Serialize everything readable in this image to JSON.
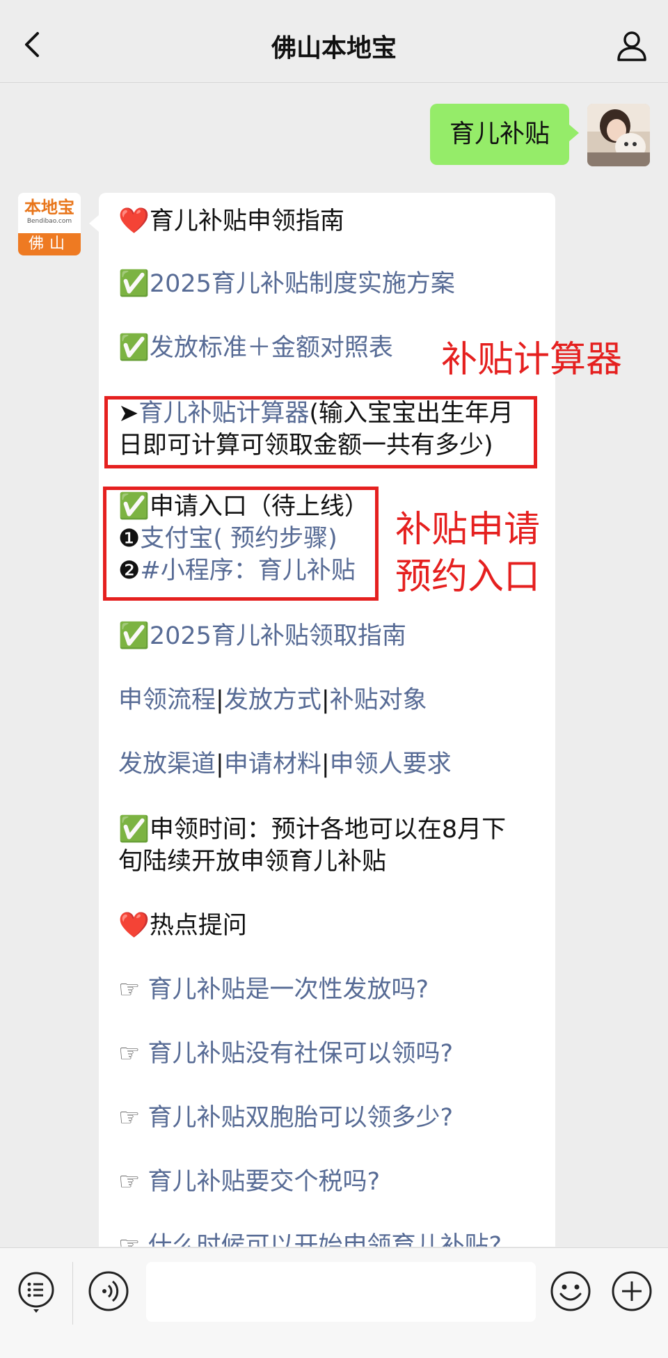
{
  "header": {
    "title": "佛山本地宝"
  },
  "me": {
    "message": "育儿补贴"
  },
  "bot": {
    "avatar_top": "本地宝",
    "avatar_url": "Bendibao.com",
    "avatar_city": "佛山"
  },
  "lines": [
    {
      "prefix": "❤️",
      "text": "育儿补贴申领指南",
      "link": false
    },
    {
      "prefix": "✅",
      "text": "2025育儿补贴制度实施方案",
      "link": true
    },
    {
      "prefix": "✅",
      "text": "发放标准＋金额对照表",
      "link": true
    },
    {
      "prefix": "➤",
      "link_text": "育儿补贴计算器",
      "text": "(输入宝宝出生年月",
      "text2": "日即可计算可领取金额一共有多少)"
    },
    {
      "prefix": "✅",
      "text": "申请入口（待上线）"
    },
    {
      "prefix": "❶",
      "text": "支付宝( 预约步骤)"
    },
    {
      "prefix": "❷",
      "text": "#小程序：育儿补贴"
    },
    {
      "prefix": "✅",
      "text": "2025育儿补贴领取指南",
      "link": true
    },
    {
      "parts": [
        "申领流程",
        "|",
        "发放方式",
        "|",
        "补贴对象"
      ]
    },
    {
      "parts": [
        "发放渠道",
        "|",
        "申请材料",
        "|",
        "申领人要求"
      ]
    },
    {
      "prefix": "✅",
      "text": "申领时间：预计各地可以在8月下",
      "text2": "旬陆续开放申领育儿补贴"
    },
    {
      "prefix": "❤️",
      "text": "热点提问"
    },
    {
      "prefix": "☞",
      "text": "育儿补贴是一次性发放吗?"
    },
    {
      "prefix": "☞",
      "text": "育儿补贴没有社保可以领吗?"
    },
    {
      "prefix": "☞",
      "text": "育儿补贴双胞胎可以领多少?"
    },
    {
      "prefix": "☞",
      "text": "育儿补贴要交个税吗?"
    },
    {
      "prefix": "☞",
      "text": "什么时候可以开始申领育儿补贴?"
    }
  ],
  "annotations": {
    "calculator": "补贴计算器",
    "apply_line1": "补贴申请",
    "apply_line2": "预约入口"
  },
  "colors": {
    "link": "#576b95",
    "red": "#e5201f",
    "bubble_green": "#95ec69"
  }
}
